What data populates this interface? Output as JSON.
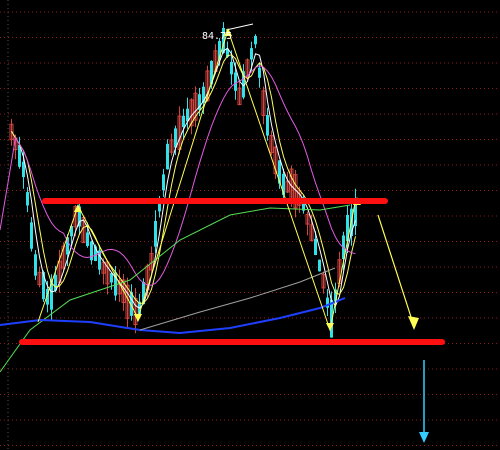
{
  "chart": {
    "peak_label": "84.75",
    "colors": {
      "background": "#000000",
      "grid": "#8b1a1a",
      "bull_candle": "#d0453f",
      "bear_candle": "#34e0e8",
      "ma_short": "#ffffff",
      "ma_mid": "#ffff66",
      "ma_long": "#e05ce0",
      "ma_longer": "#55dd55",
      "ma_slow": "#1f3fff",
      "ma_very_slow": "#a0a0a0",
      "resistance": "#ff1010",
      "projection": "#ffff55",
      "forecast_arrow": "#33ccff"
    },
    "annotations": {
      "resistance_line": "resistance",
      "support_line": "support",
      "projection": "down",
      "forecast": "down"
    }
  }
}
